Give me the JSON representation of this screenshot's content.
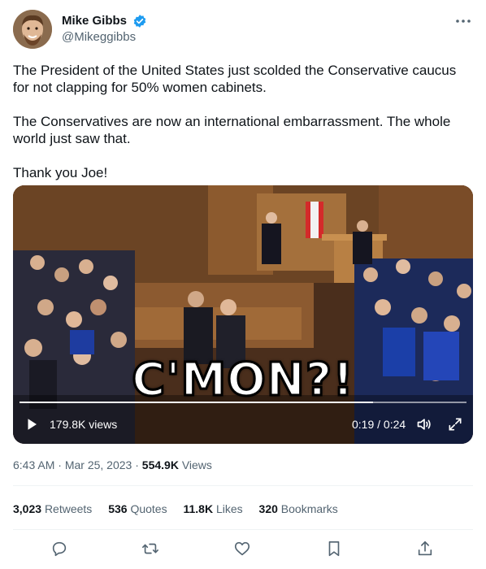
{
  "author": {
    "display_name": "Mike Gibbs",
    "handle": "@Mikeggibbs",
    "verified_color": "#1d9bf0"
  },
  "tweet": {
    "paragraphs": [
      "The President of the United States just scolded the Conservative caucus for not clapping for 50% women cabinets.",
      "The Conservatives are now an international embarrassment. The whole world just saw that.",
      "Thank you Joe!"
    ]
  },
  "video": {
    "overlay_caption": "C'MON?!",
    "views": "179.8K views",
    "time": "0:19 / 0:24",
    "progress_fraction": 0.79
  },
  "meta": {
    "time": "6:43 AM",
    "separator": "·",
    "date": "Mar 25, 2023",
    "views_count": "554.9K",
    "views_label": "Views"
  },
  "stats": [
    {
      "count": "3,023",
      "label": "Retweets"
    },
    {
      "count": "536",
      "label": "Quotes"
    },
    {
      "count": "11.8K",
      "label": "Likes"
    },
    {
      "count": "320",
      "label": "Bookmarks"
    }
  ],
  "icons": {
    "more": "more-icon",
    "reply": "reply-icon",
    "retweet": "retweet-icon",
    "like": "like-icon",
    "bookmark": "bookmark-icon",
    "share": "share-icon"
  }
}
